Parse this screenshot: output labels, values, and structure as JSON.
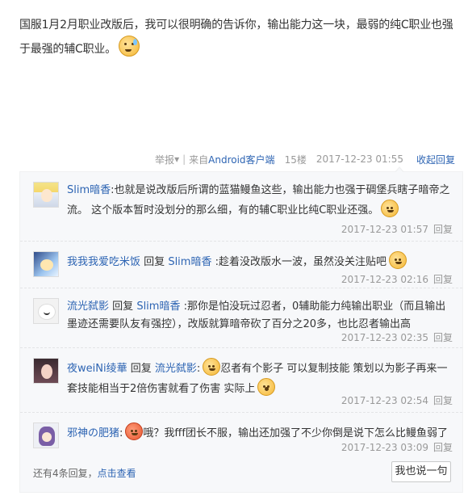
{
  "post": {
    "text": "国服1月2月职业改版后，我可以很明确的告诉你，输出能力这一块，最弱的纯C职业也强于最强的辅C职业。",
    "emoji": "sweat-smile-emoji",
    "footer": {
      "report": "举报",
      "report_arrow": "▾",
      "separator": "|",
      "source_prefix": "来自",
      "source_link": "Android客户端",
      "floor": "15楼",
      "time": "2017-12-23 01:55",
      "collapse_label": "收起回复"
    }
  },
  "replies": [
    {
      "user": "Slim暗香",
      "text_parts": [
        "",
        "也就是说改版后所谓的蓝猫鳗鱼这些，输出能力也强于碉堡兵瞎子暗帝之流。 这个版本暂时没划分的那么细，有的辅C职业比纯C职业还强。"
      ],
      "emoji": "grin-emoji",
      "time": "2017-12-23 01:57",
      "reply_label": "回复"
    },
    {
      "user": "我我我爱吃米饭",
      "reply_word": "回复",
      "target": "Slim暗香",
      "text": ":趁着没改版水一波，虽然没关注贴吧",
      "emoji": "grin-emoji",
      "time": "2017-12-23 02:16",
      "reply_label": "回复"
    },
    {
      "user": "流光弑影",
      "reply_word": "回复",
      "target": "Slim暗香",
      "text": ":那你是怕没玩过忍者，0辅助能力纯输出职业（而且输出墨迹还需要队友有强控），改版就算暗帝砍了百分之20多，也比忍者输出高",
      "time": "2017-12-23 02:35",
      "reply_label": "回复"
    },
    {
      "user": "夜weiNi绫華",
      "reply_word": "回复",
      "target": "流光弑影",
      "text_before_emoji": ":",
      "text": "忍者有个影子 可以复制技能 策划以为影子再来一套技能相当于2倍伤害就看了伤害 实际上",
      "emoji": "grin-emoji",
      "emoji2": "surprised-emoji",
      "time": "2017-12-23 02:54",
      "reply_label": "回复"
    },
    {
      "user": "邪神の肥猪",
      "text_before_emoji": ":",
      "text": "哦？我fff团长不服，输出还加强了不少你倒是说下怎么比鳗鱼弱了",
      "emoji": "angry-emoji",
      "time": "2017-12-23 03:09",
      "reply_label": "回复"
    }
  ],
  "more": {
    "prefix": "还有4条回复，",
    "link": "点击查看"
  },
  "reply_button": "我也说一句",
  "colors": {
    "link": "#2d64b3",
    "muted": "#999999",
    "panel": "#f7f8fa"
  }
}
